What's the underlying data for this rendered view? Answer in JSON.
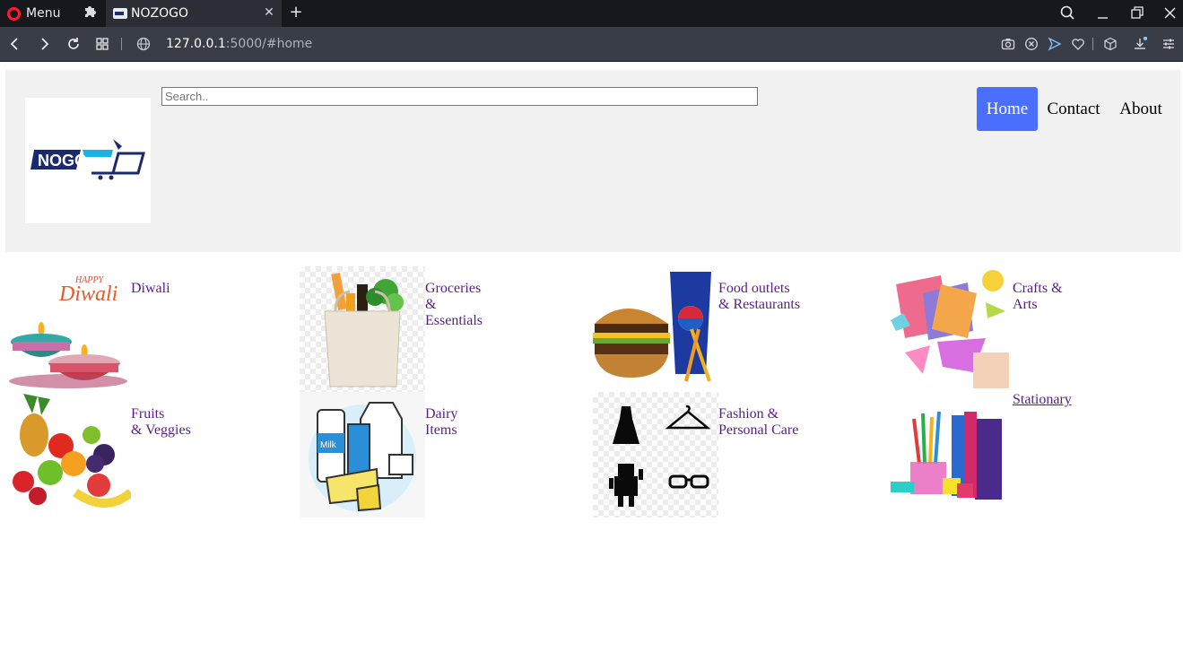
{
  "browser": {
    "menu_label": "Menu",
    "tab_title": "NOZOGO",
    "url_host": "127.0.0.1",
    "url_rest": ":5000/#home"
  },
  "header": {
    "logo_text": "NOGO",
    "search_placeholder": "Search..",
    "nav": [
      {
        "label": "Home",
        "active": true
      },
      {
        "label": "Contact",
        "active": false
      },
      {
        "label": "About",
        "active": false
      }
    ]
  },
  "categories": [
    {
      "label": "Diwali",
      "image": "diwali-lamps"
    },
    {
      "label": "Groceries\n&\nEssentials",
      "image": "grocery-bag"
    },
    {
      "label": "Food outlets\n& Restaurants",
      "image": "burger-and-soda"
    },
    {
      "label": "Crafts &\nArts",
      "image": "origami-crafts"
    },
    {
      "label": "Fruits\n& Veggies",
      "image": "fruit-basket"
    },
    {
      "label": "Dairy\nItems",
      "image": "milk-and-cheese"
    },
    {
      "label": "Fashion &\nPersonal Care",
      "image": "fashion-icons"
    },
    {
      "label": "Stationary",
      "image": "stationery-supplies"
    }
  ],
  "diwali_art_text": {
    "small": "HAPPY",
    "big": "Diwali"
  },
  "dairy_art_text": "Milk",
  "colors": {
    "accent_nav": "#4a6fff",
    "link_visited": "#5b1a8c",
    "header_bg": "#f1f1f1"
  }
}
